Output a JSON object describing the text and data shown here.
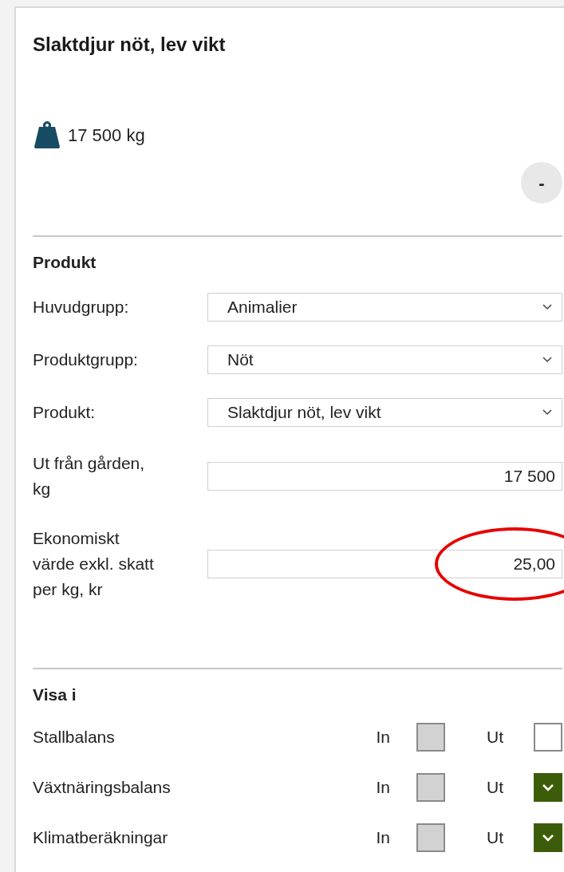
{
  "title": "Slaktdjur nöt, lev vikt",
  "weight": "17 500 kg",
  "collapse_button": "-",
  "product": {
    "heading": "Produkt",
    "fields": [
      {
        "kind": "dropdown",
        "label": "Huvudgrupp:",
        "value": "Animalier",
        "circled": false
      },
      {
        "kind": "dropdown",
        "label": "Produktgrupp:",
        "value": "Nöt",
        "circled": false
      },
      {
        "kind": "dropdown",
        "label": "Produkt:",
        "value": "Slaktdjur nöt, lev vikt",
        "circled": false
      },
      {
        "kind": "number",
        "label": "Ut från gården, kg",
        "value": "17 500",
        "circled": false
      },
      {
        "kind": "number",
        "label": "Ekonomiskt värde exkl. skatt per kg, kr",
        "value": "25,00",
        "circled": true
      }
    ]
  },
  "show_in": {
    "heading": "Visa i",
    "rows": [
      {
        "label": "Stallbalans",
        "in_label": "In",
        "in_checked": false,
        "in_disabled": true,
        "out_label": "Ut",
        "out_checked": false
      },
      {
        "label": "Växtnäringsbalans",
        "in_label": "In",
        "in_checked": false,
        "in_disabled": true,
        "out_label": "Ut",
        "out_checked": true
      },
      {
        "label": "Klimatberäkningar",
        "in_label": "In",
        "in_checked": false,
        "in_disabled": true,
        "out_label": "Ut",
        "out_checked": true
      }
    ]
  }
}
